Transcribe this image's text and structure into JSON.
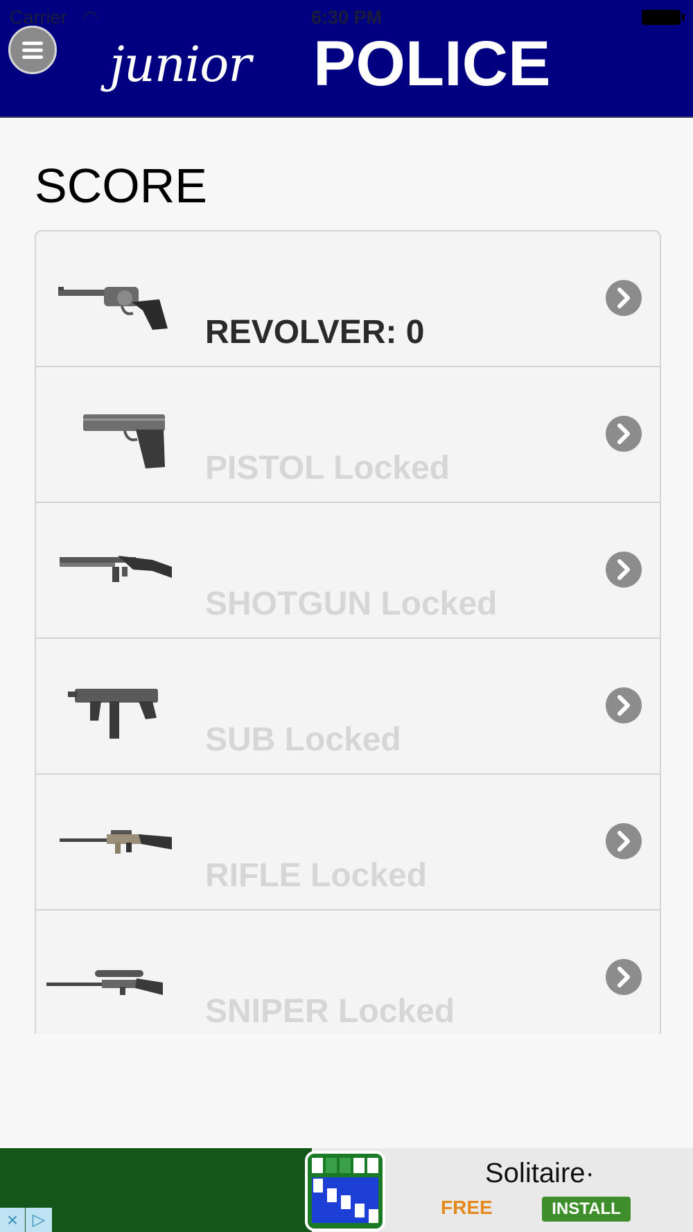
{
  "status": {
    "carrier": "Carrier",
    "time": "6:30 PM"
  },
  "header": {
    "logo_junior": "junior",
    "logo_police": "POLICE"
  },
  "page": {
    "title": "SCORE"
  },
  "weapons": [
    {
      "label": "REVOLVER: 0",
      "locked": false,
      "icon": "revolver-icon"
    },
    {
      "label": "PISTOL Locked",
      "locked": true,
      "icon": "pistol-icon"
    },
    {
      "label": "SHOTGUN Locked",
      "locked": true,
      "icon": "shotgun-icon"
    },
    {
      "label": "SUB Locked",
      "locked": true,
      "icon": "submachine-gun-icon"
    },
    {
      "label": "RIFLE Locked",
      "locked": true,
      "icon": "rifle-icon"
    },
    {
      "label": "SNIPER Locked",
      "locked": true,
      "icon": "sniper-rifle-icon"
    }
  ],
  "ad": {
    "title": "Solitaire·",
    "free": "FREE",
    "install": "INSTALL"
  },
  "colors": {
    "header_bg": "#000080",
    "locked_text": "#d6d6d6",
    "unlocked_text": "#2a2a2a",
    "ad_green": "#12561a"
  }
}
